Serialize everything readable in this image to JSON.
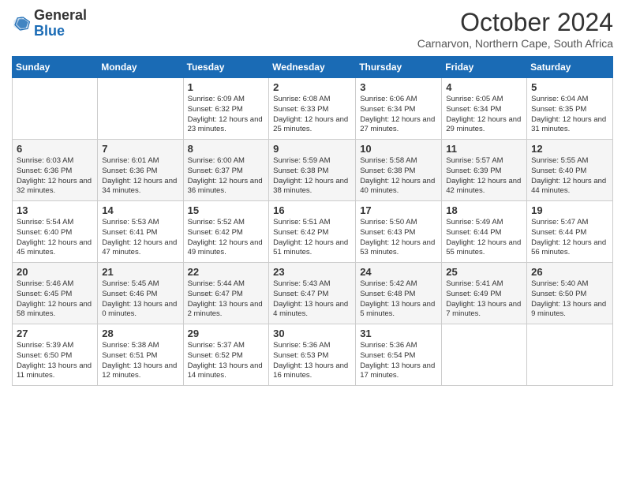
{
  "logo": {
    "line1": "General",
    "line2": "Blue"
  },
  "header": {
    "title": "October 2024",
    "subtitle": "Carnarvon, Northern Cape, South Africa"
  },
  "weekdays": [
    "Sunday",
    "Monday",
    "Tuesday",
    "Wednesday",
    "Thursday",
    "Friday",
    "Saturday"
  ],
  "weeks": [
    [
      {
        "day": "",
        "info": ""
      },
      {
        "day": "",
        "info": ""
      },
      {
        "day": "1",
        "info": "Sunrise: 6:09 AM\nSunset: 6:32 PM\nDaylight: 12 hours and 23 minutes."
      },
      {
        "day": "2",
        "info": "Sunrise: 6:08 AM\nSunset: 6:33 PM\nDaylight: 12 hours and 25 minutes."
      },
      {
        "day": "3",
        "info": "Sunrise: 6:06 AM\nSunset: 6:34 PM\nDaylight: 12 hours and 27 minutes."
      },
      {
        "day": "4",
        "info": "Sunrise: 6:05 AM\nSunset: 6:34 PM\nDaylight: 12 hours and 29 minutes."
      },
      {
        "day": "5",
        "info": "Sunrise: 6:04 AM\nSunset: 6:35 PM\nDaylight: 12 hours and 31 minutes."
      }
    ],
    [
      {
        "day": "6",
        "info": "Sunrise: 6:03 AM\nSunset: 6:36 PM\nDaylight: 12 hours and 32 minutes."
      },
      {
        "day": "7",
        "info": "Sunrise: 6:01 AM\nSunset: 6:36 PM\nDaylight: 12 hours and 34 minutes."
      },
      {
        "day": "8",
        "info": "Sunrise: 6:00 AM\nSunset: 6:37 PM\nDaylight: 12 hours and 36 minutes."
      },
      {
        "day": "9",
        "info": "Sunrise: 5:59 AM\nSunset: 6:38 PM\nDaylight: 12 hours and 38 minutes."
      },
      {
        "day": "10",
        "info": "Sunrise: 5:58 AM\nSunset: 6:38 PM\nDaylight: 12 hours and 40 minutes."
      },
      {
        "day": "11",
        "info": "Sunrise: 5:57 AM\nSunset: 6:39 PM\nDaylight: 12 hours and 42 minutes."
      },
      {
        "day": "12",
        "info": "Sunrise: 5:55 AM\nSunset: 6:40 PM\nDaylight: 12 hours and 44 minutes."
      }
    ],
    [
      {
        "day": "13",
        "info": "Sunrise: 5:54 AM\nSunset: 6:40 PM\nDaylight: 12 hours and 45 minutes."
      },
      {
        "day": "14",
        "info": "Sunrise: 5:53 AM\nSunset: 6:41 PM\nDaylight: 12 hours and 47 minutes."
      },
      {
        "day": "15",
        "info": "Sunrise: 5:52 AM\nSunset: 6:42 PM\nDaylight: 12 hours and 49 minutes."
      },
      {
        "day": "16",
        "info": "Sunrise: 5:51 AM\nSunset: 6:42 PM\nDaylight: 12 hours and 51 minutes."
      },
      {
        "day": "17",
        "info": "Sunrise: 5:50 AM\nSunset: 6:43 PM\nDaylight: 12 hours and 53 minutes."
      },
      {
        "day": "18",
        "info": "Sunrise: 5:49 AM\nSunset: 6:44 PM\nDaylight: 12 hours and 55 minutes."
      },
      {
        "day": "19",
        "info": "Sunrise: 5:47 AM\nSunset: 6:44 PM\nDaylight: 12 hours and 56 minutes."
      }
    ],
    [
      {
        "day": "20",
        "info": "Sunrise: 5:46 AM\nSunset: 6:45 PM\nDaylight: 12 hours and 58 minutes."
      },
      {
        "day": "21",
        "info": "Sunrise: 5:45 AM\nSunset: 6:46 PM\nDaylight: 13 hours and 0 minutes."
      },
      {
        "day": "22",
        "info": "Sunrise: 5:44 AM\nSunset: 6:47 PM\nDaylight: 13 hours and 2 minutes."
      },
      {
        "day": "23",
        "info": "Sunrise: 5:43 AM\nSunset: 6:47 PM\nDaylight: 13 hours and 4 minutes."
      },
      {
        "day": "24",
        "info": "Sunrise: 5:42 AM\nSunset: 6:48 PM\nDaylight: 13 hours and 5 minutes."
      },
      {
        "day": "25",
        "info": "Sunrise: 5:41 AM\nSunset: 6:49 PM\nDaylight: 13 hours and 7 minutes."
      },
      {
        "day": "26",
        "info": "Sunrise: 5:40 AM\nSunset: 6:50 PM\nDaylight: 13 hours and 9 minutes."
      }
    ],
    [
      {
        "day": "27",
        "info": "Sunrise: 5:39 AM\nSunset: 6:50 PM\nDaylight: 13 hours and 11 minutes."
      },
      {
        "day": "28",
        "info": "Sunrise: 5:38 AM\nSunset: 6:51 PM\nDaylight: 13 hours and 12 minutes."
      },
      {
        "day": "29",
        "info": "Sunrise: 5:37 AM\nSunset: 6:52 PM\nDaylight: 13 hours and 14 minutes."
      },
      {
        "day": "30",
        "info": "Sunrise: 5:36 AM\nSunset: 6:53 PM\nDaylight: 13 hours and 16 minutes."
      },
      {
        "day": "31",
        "info": "Sunrise: 5:36 AM\nSunset: 6:54 PM\nDaylight: 13 hours and 17 minutes."
      },
      {
        "day": "",
        "info": ""
      },
      {
        "day": "",
        "info": ""
      }
    ]
  ]
}
